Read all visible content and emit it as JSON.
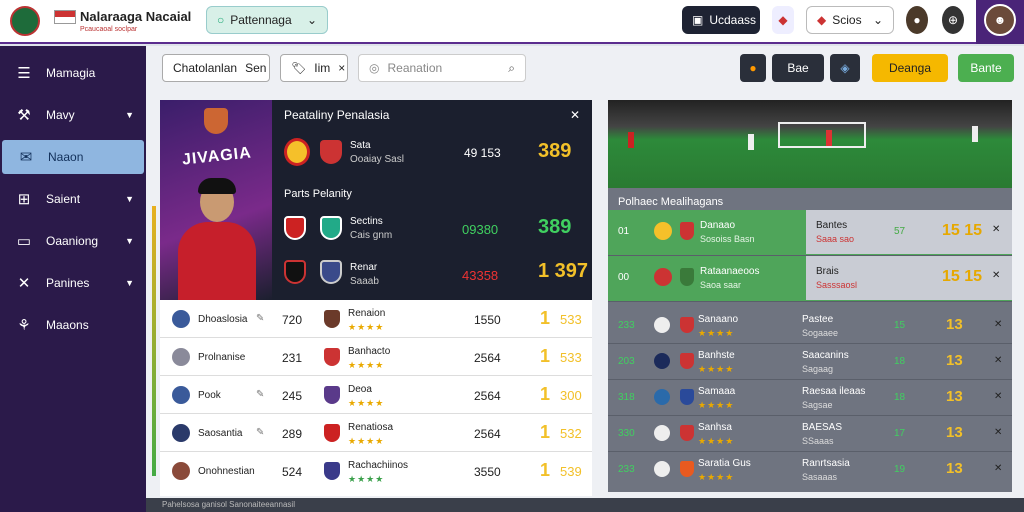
{
  "header": {
    "brand": "Nalaraaga Nacaial",
    "brand_sub": "Pcaucaoal soclpar",
    "search_pill": "Pattennaga",
    "pill_a": "Ucdaass",
    "pill_b": "Scios",
    "icon_names": [
      "shield-icon",
      "globe-icon",
      "user-icon"
    ]
  },
  "sidebar": {
    "items": [
      {
        "label": "Mamagia",
        "icon": "shield-icon",
        "chevron": false
      },
      {
        "label": "Mavy",
        "icon": "tool-icon",
        "chevron": true
      },
      {
        "label": "Naaon",
        "icon": "chat-icon",
        "chevron": false
      },
      {
        "label": "Saient",
        "icon": "grid-icon",
        "chevron": true
      },
      {
        "label": "Oaaniong",
        "icon": "board-icon",
        "chevron": true
      },
      {
        "label": "Panines",
        "icon": "x-icon",
        "chevron": true
      },
      {
        "label": "Maaons",
        "icon": "team-icon",
        "chevron": false
      }
    ]
  },
  "filters": {
    "f1": "Chatolanlan",
    "f1_val": "Sen",
    "f2": "Iim",
    "search_placeholder": "Reanation",
    "score_a": "Bae",
    "btn_yellow": "Deanga",
    "btn_green": "Bante"
  },
  "featured": {
    "title": "Peataliny Penalasia",
    "player_name": "JIVAGIA",
    "section2": "Parts Pelanity",
    "rows": [
      {
        "team": "Sata",
        "sub": "Ooaiay Sasl",
        "num": "49 153",
        "score": "389",
        "score_color": "yellow"
      },
      {
        "team": "Sectins",
        "sub": "Cais gnm",
        "num": "09380",
        "score": "389",
        "score_color": "green"
      },
      {
        "team": "Renar",
        "sub": "Saaab",
        "num": "43358",
        "score": "1 397",
        "score_color": "yellow"
      }
    ]
  },
  "list": [
    {
      "name": "Dhoaslosia",
      "num": "720",
      "team": "Renaion",
      "score": "1550",
      "big": "1",
      "small": "533",
      "stars": "★★★★",
      "stars_green": false
    },
    {
      "name": "Prolnanise",
      "num": "231",
      "team": "Banhacto",
      "score": "2564",
      "big": "1",
      "small": "533",
      "stars": "★★★★",
      "stars_green": false
    },
    {
      "name": "Pook",
      "num": "245",
      "team": "Deoa",
      "score": "2564",
      "big": "1",
      "small": "300",
      "stars": "★★★★",
      "stars_green": false
    },
    {
      "name": "Saosantia",
      "num": "289",
      "team": "Renatiosa",
      "score": "2564",
      "big": "1",
      "small": "532",
      "stars": "★★★★",
      "stars_green": false
    },
    {
      "name": "Onohnestian",
      "num": "524",
      "team": "Rachachiinos",
      "score": "3550",
      "big": "1",
      "small": "539",
      "stars": "★★★★",
      "stars_green": true
    }
  ],
  "matches": {
    "title": "Polhaec Mealihagans",
    "highlight": [
      {
        "score": "01",
        "team": "Danaao",
        "sub": "Sosoiss Basn",
        "rt": "Bantes",
        "rs": "Saaa sao",
        "a": "57",
        "b": "15 15"
      },
      {
        "score": "00",
        "team": "Rataanaeoos",
        "sub": "Saoa saar",
        "rt": "Brais",
        "rs": "Sasssaosl",
        "a": "",
        "b": "15 15"
      }
    ],
    "rows": [
      {
        "score": "233",
        "team": "Sanaano",
        "rt": "Pastee",
        "rs": "Sogaaee",
        "a": "15",
        "b": "13"
      },
      {
        "score": "203",
        "team": "Banhste",
        "rt": "Saacanins",
        "rs": "Sagaag",
        "a": "18",
        "b": "13"
      },
      {
        "score": "318",
        "team": "Samaaa",
        "rt": "Raesaa ileaas",
        "rs": "Sagsae",
        "a": "18",
        "b": "13"
      },
      {
        "score": "330",
        "team": "Sanhsa",
        "rt": "BAESAS",
        "rs": "SSaaas",
        "a": "17",
        "b": "13"
      },
      {
        "score": "233",
        "team": "Saratia Gus",
        "rt": "Ranrtsasia",
        "rs": "Sasaaas",
        "a": "19",
        "b": "13"
      }
    ]
  },
  "footer": "Pahelsosa ganisol Sanonaiteeannasil"
}
